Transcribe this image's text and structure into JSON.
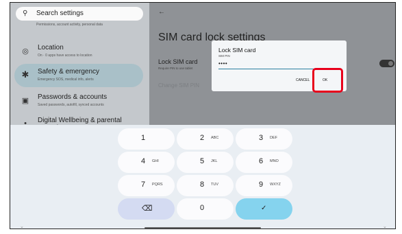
{
  "search": {
    "icon": "search-icon",
    "placeholder": "Search settings"
  },
  "sidebar": {
    "top_sub": "Permissions, account activity, personal data",
    "items": [
      {
        "icon": "location-icon",
        "title": "Location",
        "sub": "On · 0 apps have access to location"
      },
      {
        "icon": "emergency-icon",
        "title": "Safety & emergency",
        "sub": "Emergency SOS, medical info, alerts"
      },
      {
        "icon": "accounts-icon",
        "title": "Passwords & accounts",
        "sub": "Saved passwords, autofill, synced accounts"
      },
      {
        "icon": "wellbeing-icon",
        "title": "Digital Wellbeing & parental controls",
        "sub": ""
      }
    ]
  },
  "page": {
    "back": "←",
    "title": "SIM card lock settings",
    "lock_title": "Lock SIM card",
    "lock_sub": "Require PIN to use tablet",
    "change_pin": "Change SIM PIN"
  },
  "dialog": {
    "title": "Lock SIM card",
    "label": "SIM PIN",
    "value": "••••",
    "cancel": "CANCEL",
    "ok": "OK"
  },
  "keypad": {
    "keys": [
      {
        "digit": "1",
        "letters": ""
      },
      {
        "digit": "2",
        "letters": "ABC"
      },
      {
        "digit": "3",
        "letters": "DEF"
      },
      {
        "digit": "4",
        "letters": "GHI"
      },
      {
        "digit": "5",
        "letters": "JKL"
      },
      {
        "digit": "6",
        "letters": "MNO"
      },
      {
        "digit": "7",
        "letters": "PQRS"
      },
      {
        "digit": "8",
        "letters": "TUV"
      },
      {
        "digit": "9",
        "letters": "WXYZ"
      },
      {
        "digit": "⌫",
        "letters": ""
      },
      {
        "digit": "0",
        "letters": ""
      },
      {
        "digit": "✓",
        "letters": ""
      }
    ]
  },
  "nav": {
    "left": "⌄",
    "right": "⌄"
  },
  "colors": {
    "highlight": "#e8001b",
    "enter_key": "#85d3ee",
    "selected_item": "#a9c0c8"
  }
}
